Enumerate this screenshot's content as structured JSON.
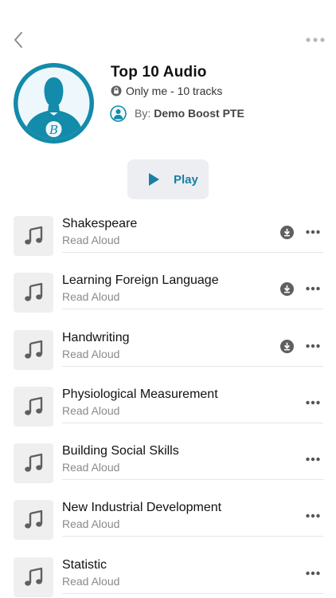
{
  "header": {
    "title": "Top 10 Audio",
    "privacy": "Only me - 10 tracks",
    "author_prefix": "By:",
    "author_name": "Demo Boost PTE",
    "cover_letter": "B"
  },
  "play_label": "Play",
  "colors": {
    "accent": "#1a7fa5",
    "cover_ring": "#138baa",
    "icon_gray": "#5f5f5f"
  },
  "icons": {
    "back": "chevron-left-icon",
    "more": "more-horizontal-icon",
    "lock": "lock-icon",
    "play": "play-icon",
    "track": "music-note-icon",
    "download": "download-icon"
  },
  "tracks": [
    {
      "title": "Shakespeare",
      "subtitle": "Read Aloud",
      "downloaded": true
    },
    {
      "title": "Learning Foreign Language",
      "subtitle": "Read Aloud",
      "downloaded": true
    },
    {
      "title": "Handwriting",
      "subtitle": "Read Aloud",
      "downloaded": true
    },
    {
      "title": "Physiological Measurement",
      "subtitle": "Read Aloud",
      "downloaded": false
    },
    {
      "title": "Building Social Skills",
      "subtitle": "Read Aloud",
      "downloaded": false
    },
    {
      "title": "New Industrial Development",
      "subtitle": "Read Aloud",
      "downloaded": false
    },
    {
      "title": "Statistic",
      "subtitle": "Read Aloud",
      "downloaded": false
    }
  ]
}
